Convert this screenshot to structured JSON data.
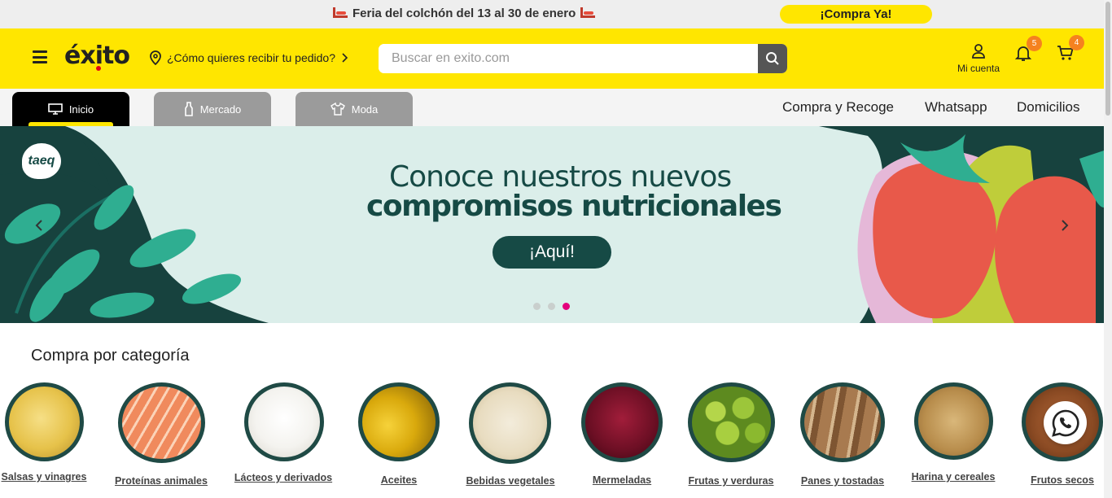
{
  "promo": {
    "text": "Feria del colchón del 13 al 30 de enero",
    "cta": "¡Compra Ya!"
  },
  "header": {
    "logo": "éxito",
    "location": "¿Cómo quieres recibir tu pedido?",
    "search_placeholder": "Buscar en exito.com",
    "account_label": "Mi cuenta",
    "notifications_count": "5",
    "cart_count": "4"
  },
  "nav": {
    "tabs": [
      {
        "label": "Inicio",
        "icon": "monitor-icon",
        "active": true
      },
      {
        "label": "Mercado",
        "icon": "bottle-icon",
        "active": false
      },
      {
        "label": "Moda",
        "icon": "shirt-icon",
        "active": false
      }
    ],
    "links": [
      "Compra y Recoge",
      "Whatsapp",
      "Domicilios"
    ]
  },
  "banner": {
    "brand": "taeq",
    "title_line1": "Conoce nuestros nuevos",
    "title_line2": "compromisos nutricionales",
    "cta": "¡Aquí!",
    "slides": 3,
    "active_slide": 3,
    "colors": {
      "background": "#dbeeea",
      "primary": "#164a45",
      "accent": "#e8594a",
      "active_dot": "#e4007c"
    }
  },
  "categories": {
    "title": "Compra por categoría",
    "items": [
      {
        "label": "Salsas y vinagres"
      },
      {
        "label": "Proteínas animales"
      },
      {
        "label": "Lácteos y derivados"
      },
      {
        "label": "Aceites"
      },
      {
        "label": "Bebidas vegetales"
      },
      {
        "label": "Mermeladas"
      },
      {
        "label": "Frutas y verduras"
      },
      {
        "label": "Panes y tostadas"
      },
      {
        "label": "Harina y cereales"
      },
      {
        "label": "Frutos secos"
      }
    ]
  },
  "colors": {
    "brand_yellow": "#ffe600",
    "badge_orange": "#f5821f",
    "logo_red": "#e30613"
  }
}
